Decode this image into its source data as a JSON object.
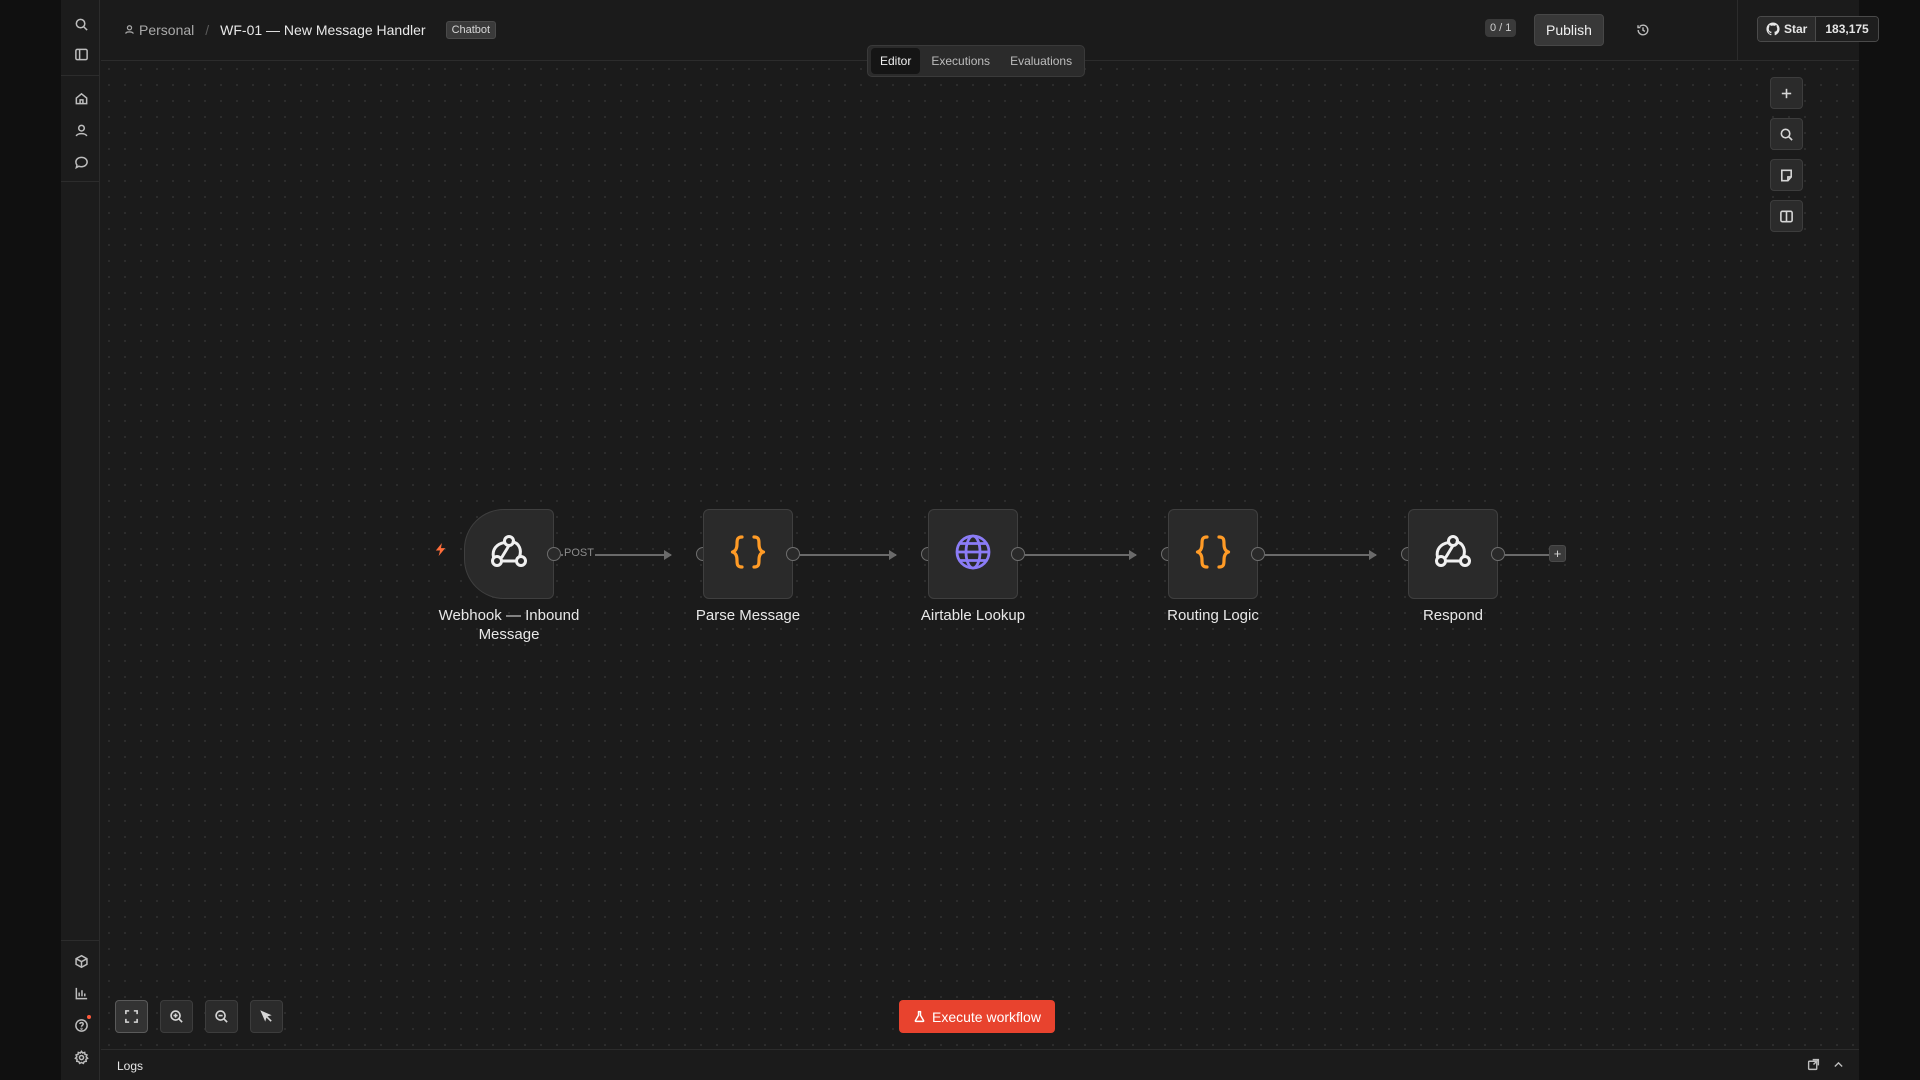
{
  "breadcrumb": {
    "owner": "Personal",
    "separator": "/",
    "workflow_title": "WF-01 — New Message Handler",
    "tag": "Chatbot"
  },
  "header": {
    "counter": "0 / 1",
    "publish_label": "Publish",
    "github": {
      "star_label": "Star",
      "star_count": "183,175"
    }
  },
  "tabs": [
    {
      "label": "Editor",
      "active": true
    },
    {
      "label": "Executions",
      "active": false
    },
    {
      "label": "Evaluations",
      "active": false
    }
  ],
  "rail": {
    "top_icons": [
      "search-icon",
      "panel-icon",
      "home-icon",
      "user-icon",
      "chat-icon"
    ],
    "bottom_icons": [
      "cube-icon",
      "chart-icon",
      "help-icon",
      "settings-icon"
    ]
  },
  "workflow": {
    "nodes": [
      {
        "label": "Webhook — Inbound Message",
        "icon": "webhook-icon",
        "trigger": true
      },
      {
        "label": "Parse Message",
        "icon": "code-braces-icon"
      },
      {
        "label": "Airtable Lookup",
        "icon": "globe-icon"
      },
      {
        "label": "Routing Logic",
        "icon": "code-braces-icon"
      },
      {
        "label": "Respond",
        "icon": "webhook-icon"
      }
    ],
    "first_edge_label": "POST",
    "add_node_label": "+"
  },
  "canvas_tools": [
    "plus-icon",
    "search-icon",
    "sticky-note-icon",
    "panel-icon"
  ],
  "zoom_tools": [
    "fit-view-icon",
    "zoom-in-icon",
    "zoom-out-icon",
    "tidy-up-icon"
  ],
  "execute_label": "Execute workflow",
  "logs": {
    "label": "Logs"
  },
  "colors": {
    "accent": "#e8432e",
    "code_icon": "#ff9b26",
    "globe_icon": "#8b7cf6",
    "bolt": "#ff6d3a"
  }
}
